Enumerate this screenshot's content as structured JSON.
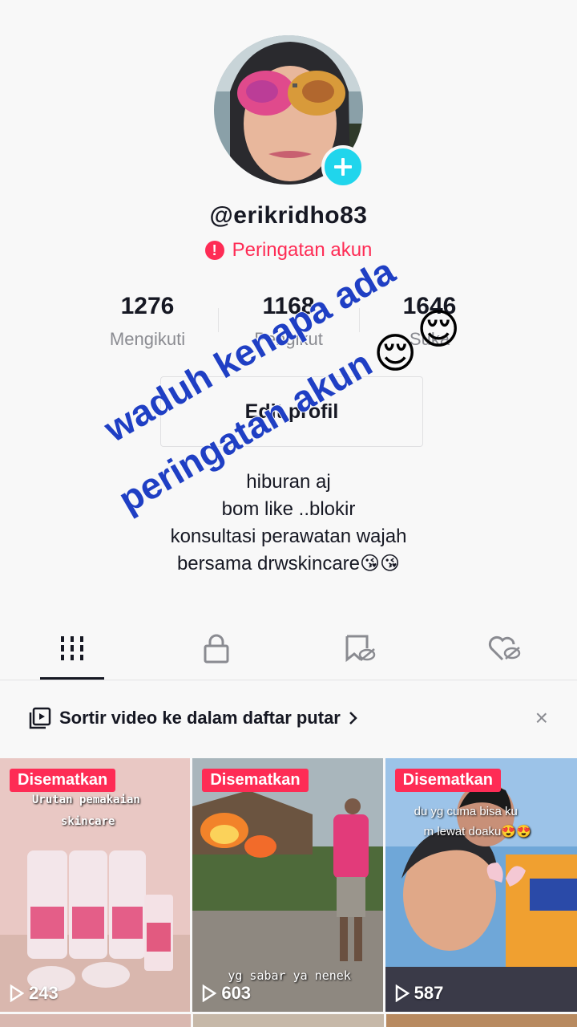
{
  "profile": {
    "username": "@erikridho83",
    "warning_label": "Peringatan akun",
    "edit_button": "Edit profil",
    "bio": [
      "hiburan aj",
      "bom like ..blokir",
      "konsultasi perawatan wajah",
      "bersama drwskincare😘😘"
    ]
  },
  "stats": [
    {
      "value": "1276",
      "label": "Mengikuti"
    },
    {
      "value": "1168",
      "label": "Pengikut"
    },
    {
      "value": "1646",
      "label": "Suka"
    }
  ],
  "overlay_text": {
    "line1": "waduh kenapa ada",
    "line2": "peringatan akun",
    "emoji": "😌"
  },
  "tabs": [
    {
      "icon": "grid-icon",
      "active": true
    },
    {
      "icon": "lock-icon",
      "active": false
    },
    {
      "icon": "tagged-hidden-icon",
      "active": false
    },
    {
      "icon": "liked-hidden-icon",
      "active": false
    }
  ],
  "playlist_bar": {
    "text": "Sortir video ke dalam daftar putar",
    "icon": "playlist-icon"
  },
  "videos": [
    {
      "badge": "Disematkan",
      "views": "243",
      "caption": [
        "Urutan pemakaian",
        "skincare"
      ]
    },
    {
      "badge": "Disematkan",
      "views": "603",
      "caption": [
        "yg sabar ya nenek"
      ]
    },
    {
      "badge": "Disematkan",
      "views": "587",
      "caption": [
        "du yg cuma bisa ku",
        "m lewat doaku😍😍"
      ]
    }
  ],
  "colors": {
    "accent": "#fe2c55",
    "add_button": "#20d5ec",
    "overlay_text": "#1f3fc4",
    "background": "#f8f8f8"
  }
}
